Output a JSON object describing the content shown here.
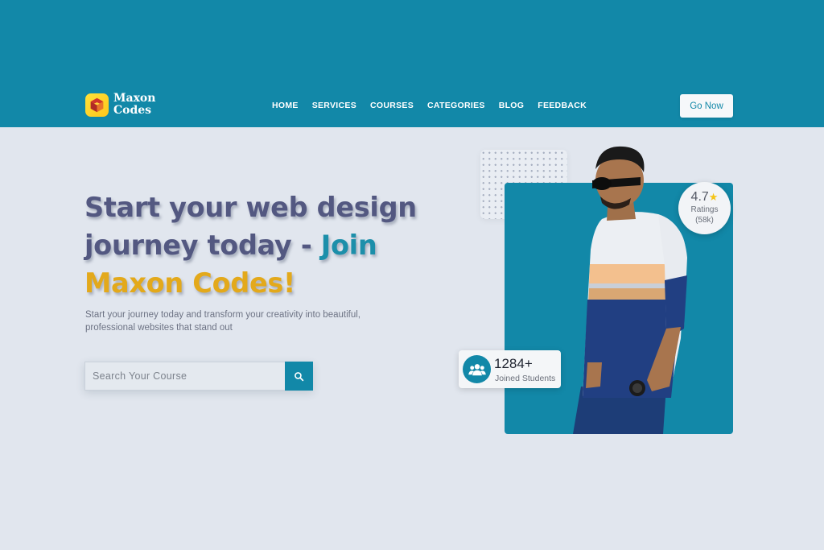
{
  "brand": {
    "name_line1": "Maxon",
    "name_line2": "Codes",
    "logo_icon": "cube-logo-icon"
  },
  "nav": {
    "items": [
      {
        "label": "HOME"
      },
      {
        "label": "SERVICES"
      },
      {
        "label": "COURSES"
      },
      {
        "label": "CATEGORIES"
      },
      {
        "label": "BLOG"
      },
      {
        "label": "FEEDBACK"
      }
    ],
    "cta_label": "Go Now"
  },
  "hero": {
    "title_part1": "Start your web design journey today - ",
    "title_part2": "Join",
    "title_part3": "Maxon Codes!",
    "subtitle": "Start your journey today and transform your creativity into beautiful, professional websites that stand out"
  },
  "search": {
    "placeholder": "Search Your Course",
    "button_icon": "search-icon"
  },
  "rating": {
    "value": "4.7",
    "star_icon": "star-icon",
    "label": "Ratings",
    "count": "(58k)"
  },
  "students": {
    "icon": "users-icon",
    "count": "1284+",
    "label": "Joined Students"
  },
  "colors": {
    "primary": "#1288a8",
    "heading": "#535881",
    "accent_teal": "#1c8faa",
    "accent_gold": "#e3a91b",
    "background": "#e1e6ee",
    "logo_yellow": "#ffc61a",
    "star": "#f5c518"
  }
}
